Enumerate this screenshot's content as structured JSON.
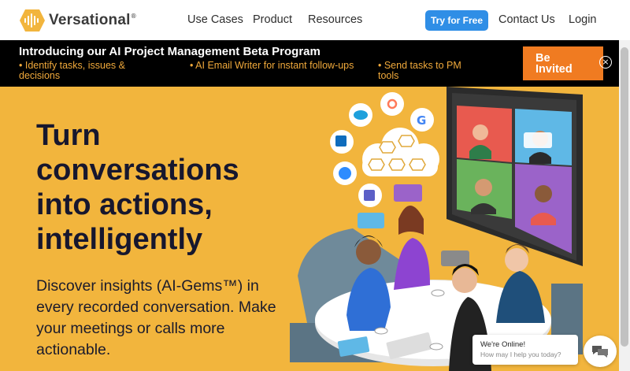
{
  "nav": {
    "brand": "Versational",
    "brand_mark": "®",
    "links": [
      "Use Cases",
      "Product",
      "Resources"
    ],
    "cta": "Try for Free",
    "contact": "Contact Us",
    "login": "Login"
  },
  "banner": {
    "title": "Introducing our AI Project Management Beta Program",
    "bullets": [
      "• Identify tasks, issues & decisions",
      "• AI Email Writer for instant follow-ups",
      "• Send tasks to PM tools"
    ],
    "button_line1": "Be",
    "button_line2": "Invited",
    "close_icon": "×"
  },
  "hero": {
    "headline": "Turn conversations into actions, intelligently",
    "subtext": "Discover insights (AI-Gems™) in every recorded conversation. Make your meetings or calls more actionable."
  },
  "chat": {
    "title": "We're Online!",
    "subtitle": "How may I help you today?"
  },
  "colors": {
    "hero_bg": "#f2b53d",
    "banner_bg": "#000000",
    "accent_orange": "#f07b21",
    "cta_blue": "#2f8ee6",
    "bullet_orange": "#f0a93b"
  }
}
